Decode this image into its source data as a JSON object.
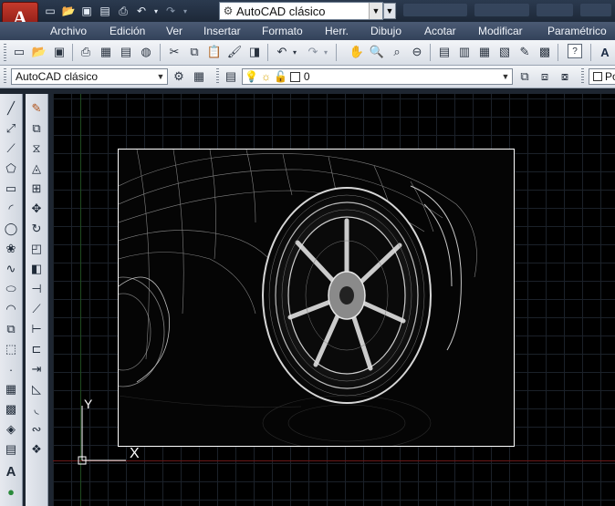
{
  "app": {
    "logo_letter": "A",
    "logo_color": "#b52a1f"
  },
  "quick_access": {
    "icons": [
      "new-icon",
      "open-icon",
      "save-icon",
      "save-as-icon",
      "print-icon",
      "undo-icon",
      "redo-icon"
    ],
    "workspace": "AutoCAD clásico"
  },
  "menu": {
    "items": [
      "Archivo",
      "Edición",
      "Ver",
      "Insertar",
      "Formato",
      "Herr.",
      "Dibujo",
      "Acotar",
      "Modificar",
      "Paramétrico"
    ]
  },
  "standard_toolbar": {
    "icons": [
      "new-icon",
      "open-icon",
      "save-icon",
      "print-icon",
      "plot-preview-icon",
      "publish-icon",
      "3d-print-icon",
      "cut-icon",
      "copy-icon",
      "paste-icon",
      "match-properties-icon",
      "block-editor-icon",
      "undo-icon",
      "redo-icon",
      "pan-icon",
      "zoom-realtime-icon",
      "zoom-window-icon",
      "zoom-previous-icon",
      "properties-icon",
      "design-center-icon",
      "tool-palettes-icon",
      "sheet-set-icon",
      "markup-icon",
      "calculator-icon",
      "help-icon",
      "text-style-icon"
    ]
  },
  "workspace_toolbar": {
    "workspace_value": "AutoCAD clásico"
  },
  "layers_toolbar": {
    "layer_value": "0",
    "right_label": "Po"
  },
  "canvas": {
    "ucs_x": "X",
    "ucs_y": "Y"
  }
}
